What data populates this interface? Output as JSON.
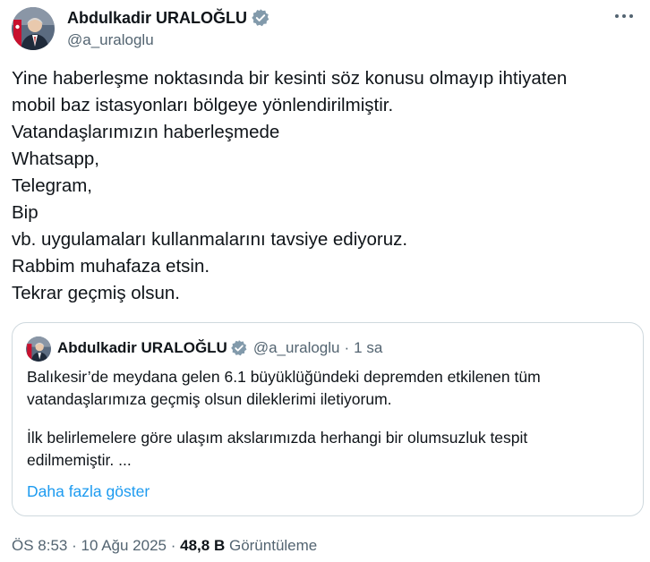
{
  "colors": {
    "text_primary": "#0f1419",
    "text_secondary": "#536471",
    "link": "#1d9bf0",
    "verified_badge": "#829aab",
    "border": "#cfd9de"
  },
  "author": {
    "name": "Abdulkadir URALOĞLU",
    "handle": "@a_uraloglu",
    "verified_icon": "verified-badge-icon",
    "avatar_icon": "avatar-image"
  },
  "more_icon": "more-options-icon",
  "tweet": {
    "lines": [
      "Yine haberleşme noktasında bir kesinti söz konusu olmayıp ihtiyaten",
      "mobil baz istasyonları bölgeye yönlendirilmiştir.",
      "Vatandaşlarımızın haberleşmede",
      "Whatsapp,",
      "Telegram,",
      "Bip",
      "vb. uygulamaları kullanmalarını tavsiye ediyoruz.",
      "Rabbim muhafaza etsin.",
      "Tekrar geçmiş olsun."
    ]
  },
  "quote": {
    "name": "Abdulkadir URALOĞLU",
    "handle": "@a_uraloglu",
    "separator": "·",
    "time": "1 sa",
    "paragraph1": [
      "Balıkesir’de meydana gelen 6.1 büyüklüğündeki depremden etkilenen tüm",
      "vatandaşlarımıza geçmiş olsun dileklerimi iletiyorum."
    ],
    "paragraph2": [
      "İlk belirlemelere göre ulaşım akslarımızda herhangi bir olumsuzluk tespit",
      "edilmemiştir. ..."
    ],
    "show_more": "Daha fazla göster"
  },
  "meta": {
    "time": "ÖS 8:53",
    "separator": "·",
    "date": "10 Ağu 2025",
    "views_count": "48,8 B",
    "views_label": "Görüntüleme"
  }
}
